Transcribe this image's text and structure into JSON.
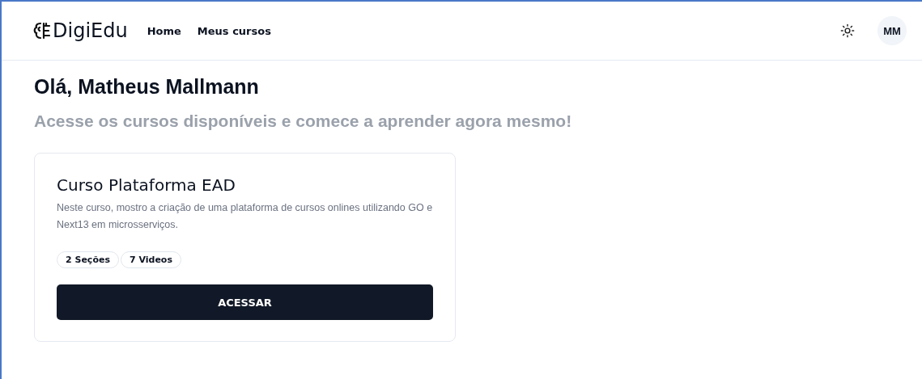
{
  "header": {
    "brand": "DigiEdu",
    "nav": [
      {
        "label": "Home"
      },
      {
        "label": "Meus cursos"
      }
    ],
    "avatar": "MM"
  },
  "greeting": "Olá, Matheus Mallmann",
  "subtitle": "Acesse os cursos disponíveis e comece a aprender agora mesmo!",
  "courses": [
    {
      "title": "Curso Plataforma EAD",
      "description": "Neste curso, mostro a criação de uma plataforma de cursos onlines utilizando GO e Next13 em microsserviços.",
      "tags": [
        "2 Seções",
        "7 Videos"
      ],
      "button": "ACESSAR"
    }
  ]
}
